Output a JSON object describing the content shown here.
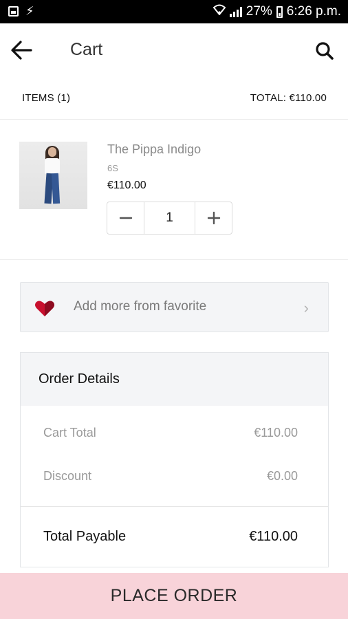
{
  "status_bar": {
    "battery": "27%",
    "time": "6:26 p.m."
  },
  "app_bar": {
    "title": "Cart",
    "back_icon": "arrow-left-icon",
    "search_icon": "search-icon"
  },
  "summary": {
    "items": "ITEMS (1)",
    "total": "TOTAL: €110.00"
  },
  "cart_items": [
    {
      "name": "The Pippa Indigo",
      "size": "6S",
      "price": "€110.00",
      "quantity": "1",
      "decrement": "−",
      "increment": "+"
    }
  ],
  "favorite": {
    "label": "Add more from favorite",
    "icon": "heart-icon",
    "chevron": "›"
  },
  "order_details": {
    "title": "Order Details",
    "cart_total_label": "Cart Total",
    "cart_total_value": "€110.00",
    "discount_label": "Discount",
    "discount_value": "€0.00",
    "total_label": "Total Payable",
    "total_value": "€110.00"
  },
  "place_order": {
    "label": "PLACE ORDER"
  },
  "colors": {
    "place_order_bg": "#f8d3d9",
    "heart": "#c8102e"
  }
}
